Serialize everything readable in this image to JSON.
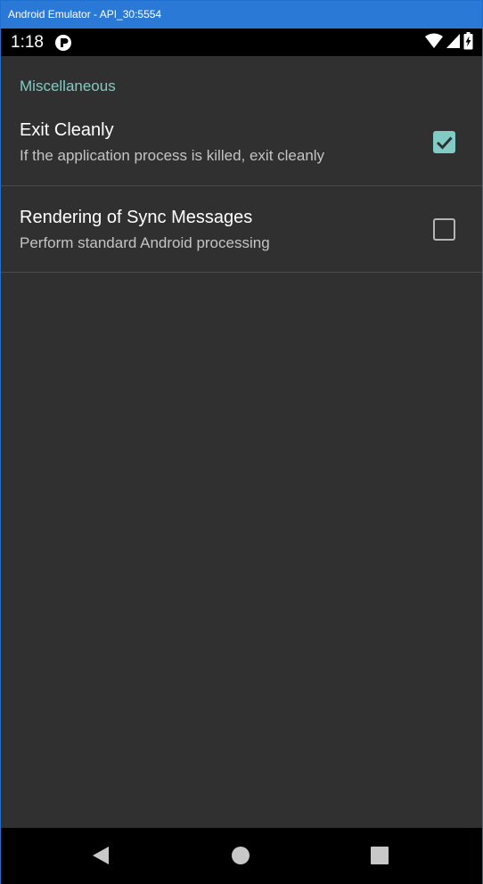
{
  "window": {
    "title": "Android Emulator - API_30:5554"
  },
  "status_bar": {
    "time": "1:18",
    "icons": [
      "app-notification-icon",
      "wifi-icon",
      "cell-signal-icon",
      "battery-charging-icon"
    ]
  },
  "preferences": {
    "category": "Miscellaneous",
    "items": [
      {
        "title": "Exit Cleanly",
        "summary": "If the application process is killed, exit cleanly",
        "checked": true
      },
      {
        "title": "Rendering of Sync Messages",
        "summary": "Perform standard Android processing",
        "checked": false
      }
    ]
  },
  "nav_bar": {
    "buttons": [
      "back-icon",
      "home-icon",
      "recents-icon"
    ]
  },
  "colors": {
    "accent": "#80cbc4",
    "background": "#303030",
    "title_bar": "#2b79d6",
    "system_bars": "#000000"
  }
}
